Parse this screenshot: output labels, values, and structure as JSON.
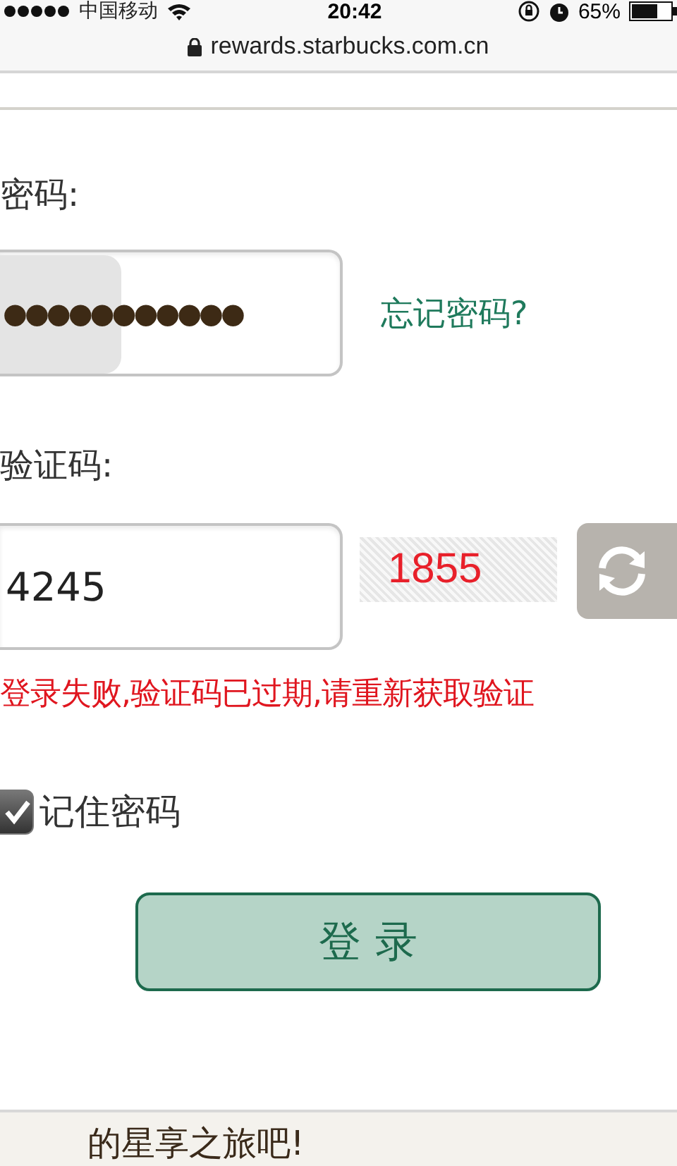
{
  "status_bar": {
    "carrier": "中国移动",
    "time": "20:42",
    "battery": "65%"
  },
  "address_bar": {
    "url": "rewards.starbucks.com.cn"
  },
  "form": {
    "password_label": "密码:",
    "password_value": "●●●●●●●●●●●",
    "forgot_link": "忘记密码?",
    "captcha_label": "验证码:",
    "captcha_value": "4245",
    "captcha_image": "1855",
    "error": "登录失败,验证码已过期,请重新获取验证",
    "remember": {
      "label": "记住密码",
      "checked": true
    },
    "login_button": "登 录"
  },
  "footer": {
    "text": "的星享之旅吧!"
  }
}
